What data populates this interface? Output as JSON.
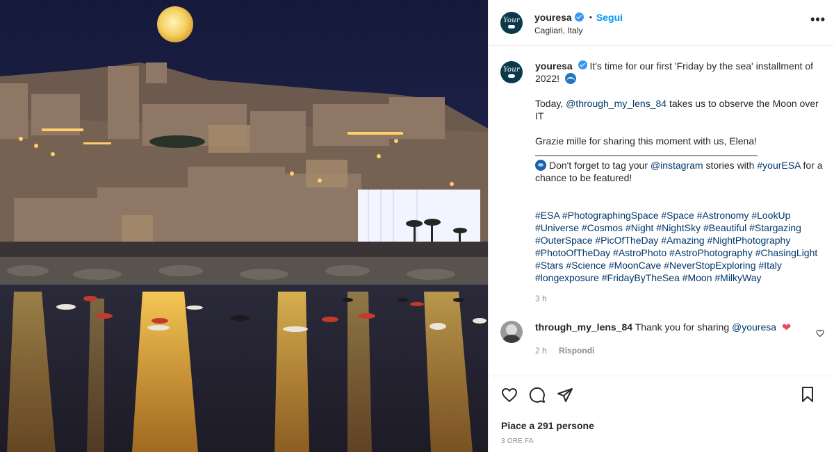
{
  "photo": {
    "alt_icon": "photo-of-cagliari-moon"
  },
  "header": {
    "username": "youresa",
    "separator": "•",
    "follow_label": "Segui",
    "location": "Cagliari, Italy",
    "more_icon": "more-options-icon",
    "avatar_text": "Your"
  },
  "caption": {
    "username": "youresa",
    "line1": "It's time for our first 'Friday by the sea' installment of 2022!",
    "line2_pre": "Today, ",
    "line2_mention": "@through_my_lens_84",
    "line2_post": " takes us to observe the Moon over IT",
    "line3": "Grazie mille for sharing this moment with us, Elena!",
    "line4_pre": "Don't forget to tag your ",
    "line4_mention": "@instagram",
    "line4_mid": " stories with ",
    "line4_tag": "#yourESA",
    "line4_post": " for a chance to be featured!",
    "hashtags": "#ESA #PhotographingSpace #Space #Astronomy #LookUp #Universe #Cosmos #Night #NightSky #Beautiful #Stargazing #OuterSpace #PicOfTheDay #Amazing #NightPhotography #PhotoOfTheDay #AstroPhoto #AstroPhotography #ChasingLight #Stars #Science #MoonCave #NeverStopExploring #Italy #longexposure #FridayByTheSea #Moon #MilkyWay",
    "time": "3 h"
  },
  "reply": {
    "username": "through_my_lens_84",
    "text": "Thank you for sharing ",
    "mention": "@youresa",
    "heart": "❤",
    "time": "2 h",
    "reply_label": "Rispondi"
  },
  "actions": {
    "icons": [
      "heart-icon",
      "comment-icon",
      "share-icon",
      "save-icon"
    ],
    "likes": "Piace a 291 persone",
    "posted": "3 ORE FA"
  }
}
